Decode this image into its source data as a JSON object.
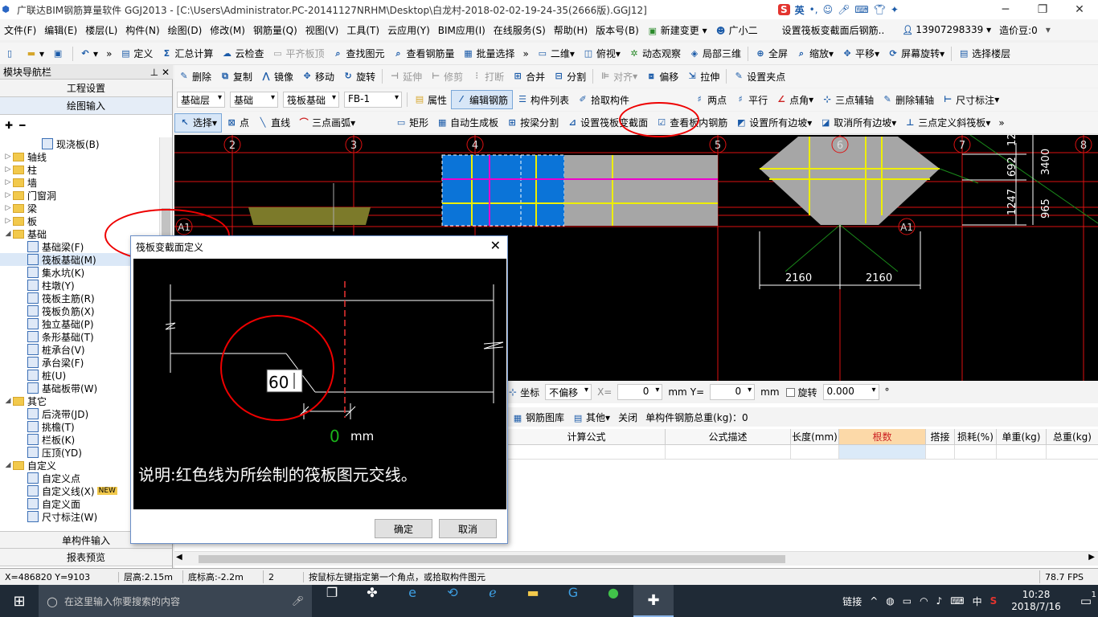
{
  "window": {
    "title": "广联达BIM钢筋算量软件 GGJ2013 - [C:\\Users\\Administrator.PC-20141127NRHM\\Desktop\\白龙村-2018-02-02-19-24-35(2666版).GGJ12]"
  },
  "ime": {
    "label": "英"
  },
  "menu": [
    "文件(F)",
    "编辑(E)",
    "楼层(L)",
    "构件(N)",
    "绘图(D)",
    "修改(M)",
    "钢筋量(Q)",
    "视图(V)",
    "工具(T)",
    "云应用(Y)",
    "BIM应用(I)",
    "在线服务(S)",
    "帮助(H)",
    "版本号(B)",
    "新建变更",
    "广小二",
    "设置筏板变截面后钢筋..",
    "13907298339",
    "造价豆:0"
  ],
  "toolbar1": [
    "定义",
    "汇总计算",
    "云检查",
    "平齐板顶",
    "查找图元",
    "查看钢筋量",
    "批量选择",
    "二维",
    "俯视",
    "动态观察",
    "局部三维",
    "全屏",
    "缩放",
    "平移",
    "屏幕旋转",
    "选择楼层"
  ],
  "toolbar2": [
    "删除",
    "复制",
    "镜像",
    "移动",
    "旋转",
    "延伸",
    "修剪",
    "打断",
    "合并",
    "分割",
    "对齐",
    "偏移",
    "拉伸",
    "设置夹点"
  ],
  "toolbar3": {
    "floor": "基础层",
    "cat": "基础",
    "type": "筏板基础",
    "name": "FB-1",
    "items": [
      "属性",
      "编辑钢筋",
      "构件列表",
      "拾取构件",
      "两点",
      "平行",
      "点角",
      "三点辅轴",
      "删除辅轴",
      "尺寸标注"
    ]
  },
  "toolbar4": [
    "选择",
    "点",
    "直线",
    "三点画弧",
    "矩形",
    "自动生成板",
    "按梁分割",
    "设置筏板变截面",
    "查看板内钢筋",
    "设置所有边坡",
    "取消所有边坡",
    "三点定义斜筏板"
  ],
  "panel": {
    "title": "模块导航栏",
    "sec1": "工程设置",
    "sec2": "绘图输入",
    "tree": [
      {
        "label": "现浇板(B)",
        "level": 2,
        "type": "item"
      },
      {
        "label": "轴线",
        "level": 0,
        "type": "folder",
        "tog": "+"
      },
      {
        "label": "柱",
        "level": 0,
        "type": "folder",
        "tog": "+"
      },
      {
        "label": "墙",
        "level": 0,
        "type": "folder",
        "tog": "+"
      },
      {
        "label": "门窗洞",
        "level": 0,
        "type": "folder",
        "tog": "+"
      },
      {
        "label": "梁",
        "level": 0,
        "type": "folder",
        "tog": "+"
      },
      {
        "label": "板",
        "level": 0,
        "type": "folder",
        "tog": "+"
      },
      {
        "label": "基础",
        "level": 0,
        "type": "folder",
        "tog": "-"
      },
      {
        "label": "基础梁(F)",
        "level": 1,
        "type": "item"
      },
      {
        "label": "筏板基础(M)",
        "level": 1,
        "type": "item"
      },
      {
        "label": "集水坑(K)",
        "level": 1,
        "type": "item"
      },
      {
        "label": "柱墩(Y)",
        "level": 1,
        "type": "item"
      },
      {
        "label": "筏板主筋(R)",
        "level": 1,
        "type": "item"
      },
      {
        "label": "筏板负筋(X)",
        "level": 1,
        "type": "item"
      },
      {
        "label": "独立基础(P)",
        "level": 1,
        "type": "item"
      },
      {
        "label": "条形基础(T)",
        "level": 1,
        "type": "item"
      },
      {
        "label": "桩承台(V)",
        "level": 1,
        "type": "item"
      },
      {
        "label": "承台梁(F)",
        "level": 1,
        "type": "item"
      },
      {
        "label": "桩(U)",
        "level": 1,
        "type": "item"
      },
      {
        "label": "基础板带(W)",
        "level": 1,
        "type": "item"
      },
      {
        "label": "其它",
        "level": 0,
        "type": "folder",
        "tog": "-"
      },
      {
        "label": "后浇带(JD)",
        "level": 1,
        "type": "item"
      },
      {
        "label": "挑檐(T)",
        "level": 1,
        "type": "item"
      },
      {
        "label": "栏板(K)",
        "level": 1,
        "type": "item"
      },
      {
        "label": "压顶(YD)",
        "level": 1,
        "type": "item"
      },
      {
        "label": "自定义",
        "level": 0,
        "type": "folder",
        "tog": "-"
      },
      {
        "label": "自定义点",
        "level": 1,
        "type": "item"
      },
      {
        "label": "自定义线(X)",
        "level": 1,
        "type": "item",
        "badge": "NEW"
      },
      {
        "label": "自定义面",
        "level": 1,
        "type": "item"
      },
      {
        "label": "尺寸标注(W)",
        "level": 1,
        "type": "item"
      }
    ],
    "sec3": "单构件输入",
    "sec4": "报表预览"
  },
  "canvas": {
    "axes": [
      "2",
      "3",
      "4",
      "5",
      "6",
      "7",
      "8"
    ],
    "rowaxis": "A1",
    "dims": [
      "3400",
      "692",
      "12",
      "1247",
      "965",
      "2160",
      "2160"
    ]
  },
  "lower": {
    "row1": {
      "coord": "坐标",
      "offset": "不偏移",
      "x_label": "X=",
      "x_value": "0",
      "y_label": "Y=",
      "y_value": "0",
      "unit": "mm",
      "rotate": "旋转",
      "rotate_value": "0.000",
      "deg": "°"
    },
    "row2": {
      "lib": "钢筋图库",
      "other": "其他",
      "close": "关闭",
      "total": "单构件钢筋总重(kg)：0"
    },
    "headers": [
      "计算公式",
      "公式描述",
      "长度(mm)",
      "根数",
      "搭接",
      "损耗(%)",
      "单重(kg)",
      "总重(kg)"
    ]
  },
  "dialog": {
    "title": "筏板变截面定义",
    "value": "60",
    "green_value": "0",
    "unit": "mm",
    "note": "说明:红色线为所绘制的筏板图元交线。",
    "ok": "确定",
    "cancel": "取消"
  },
  "status": [
    "X=486820 Y=9103",
    "层高:2.15m",
    "底标高:-2.2m",
    "2",
    "按鼠标左键指定第一个角点，或拾取构件图元",
    "78.7 FPS"
  ],
  "taskbar": {
    "search": "在这里输入你要搜索的内容",
    "tray_link": "链接",
    "ime": "中",
    "time": "10:28",
    "date": "2018/7/16",
    "notify": "1"
  }
}
